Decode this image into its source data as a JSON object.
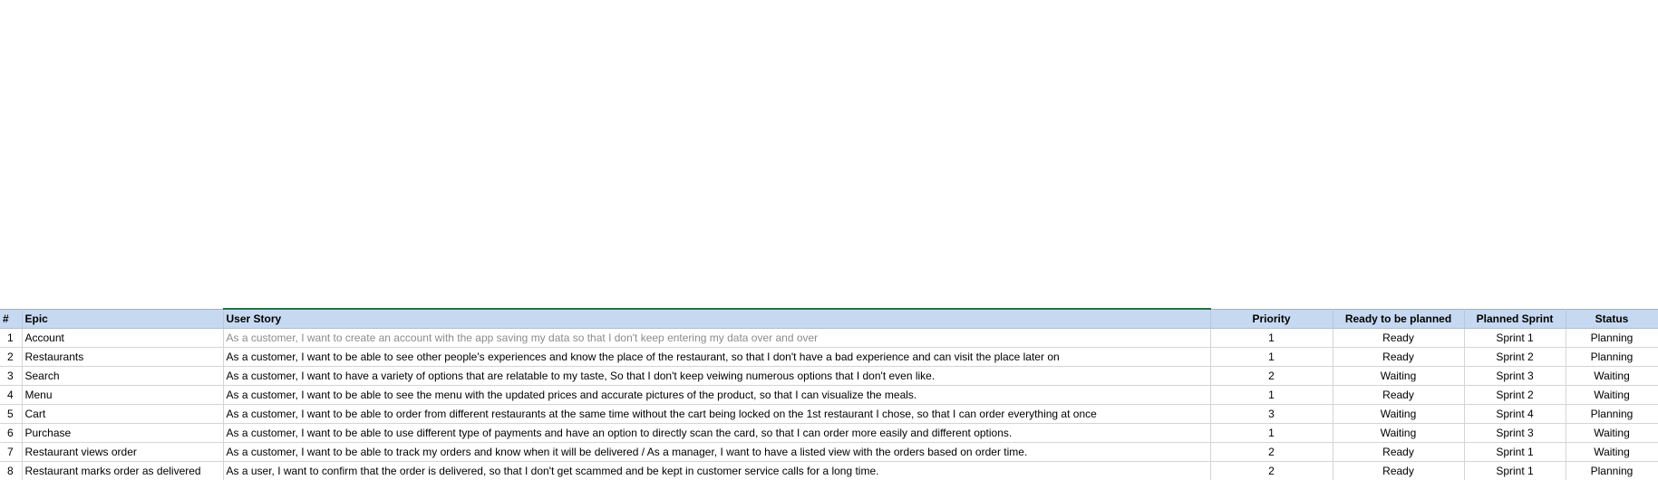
{
  "columns": {
    "num": "#",
    "epic": "Epic",
    "story": "User Story",
    "priority": "Priority",
    "ready": "Ready to be planned",
    "sprint": "Planned Sprint",
    "status": "Status"
  },
  "rows": [
    {
      "num": "1",
      "epic": "Account",
      "story": "As a customer, I want to create an account with the app saving my data so that I don't keep entering my data over and over",
      "priority": "1",
      "ready": "Ready",
      "sprint": "Sprint 1",
      "status": "Planning"
    },
    {
      "num": "2",
      "epic": "Restaurants",
      "story": "As a customer, I want to be able to see other people's experiences and know the place of the restaurant, so that I don't have a bad experience and can visit the place later on",
      "priority": "1",
      "ready": "Ready",
      "sprint": "Sprint 2",
      "status": "Planning"
    },
    {
      "num": "3",
      "epic": "Search",
      "story": "As a customer, I want to have a variety of options that are relatable to my taste, So that I don't keep veiwing numerous options that I don't even like.",
      "priority": "2",
      "ready": "Waiting",
      "sprint": "Sprint 3",
      "status": "Waiting"
    },
    {
      "num": "4",
      "epic": "Menu",
      "story": "As a customer, I want to be able to see the menu with the updated prices and accurate pictures of the product, so that I can visualize the meals.",
      "priority": "1",
      "ready": "Ready",
      "sprint": "Sprint 2",
      "status": "Waiting"
    },
    {
      "num": "5",
      "epic": "Cart",
      "story": "As a customer, I want to be able to order from different restaurants at the same time without the cart being locked on the 1st restaurant I chose, so that I can order everything at once",
      "priority": "3",
      "ready": "Waiting",
      "sprint": "Sprint 4",
      "status": "Planning"
    },
    {
      "num": "6",
      "epic": "Purchase",
      "story": "As a customer, I want to be able to use different type of payments and have an option to directly scan the card, so that I can order more easily and different options.",
      "priority": "1",
      "ready": "Waiting",
      "sprint": "Sprint 3",
      "status": "Waiting"
    },
    {
      "num": "7",
      "epic": "Restaurant views order",
      "story": "As a customer, I want to be able to track my orders and know when it will be delivered / As a manager, I want to have a listed view with the orders based on order time.",
      "priority": "2",
      "ready": "Ready",
      "sprint": "Sprint 1",
      "status": "Waiting"
    },
    {
      "num": "8",
      "epic": "Restaurant marks order as delivered",
      "story": "As a user, I want to confirm that the order is delivered, so that I don't get scammed and be kept in customer service calls for a long time.",
      "priority": "2",
      "ready": "Ready",
      "sprint": "Sprint 1",
      "status": "Planning"
    }
  ]
}
